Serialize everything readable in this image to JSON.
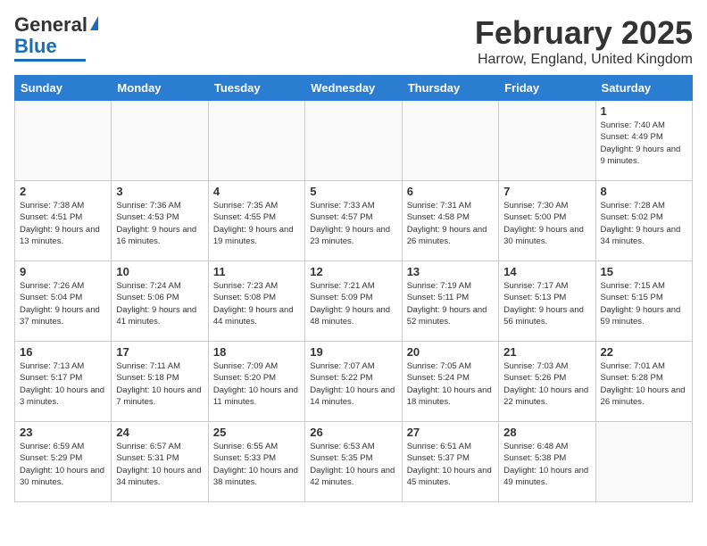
{
  "header": {
    "logo_line1": "General",
    "logo_line2": "Blue",
    "month_title": "February 2025",
    "location": "Harrow, England, United Kingdom"
  },
  "weekdays": [
    "Sunday",
    "Monday",
    "Tuesday",
    "Wednesday",
    "Thursday",
    "Friday",
    "Saturday"
  ],
  "weeks": [
    [
      {
        "day": "",
        "info": ""
      },
      {
        "day": "",
        "info": ""
      },
      {
        "day": "",
        "info": ""
      },
      {
        "day": "",
        "info": ""
      },
      {
        "day": "",
        "info": ""
      },
      {
        "day": "",
        "info": ""
      },
      {
        "day": "1",
        "info": "Sunrise: 7:40 AM\nSunset: 4:49 PM\nDaylight: 9 hours and 9 minutes."
      }
    ],
    [
      {
        "day": "2",
        "info": "Sunrise: 7:38 AM\nSunset: 4:51 PM\nDaylight: 9 hours and 13 minutes."
      },
      {
        "day": "3",
        "info": "Sunrise: 7:36 AM\nSunset: 4:53 PM\nDaylight: 9 hours and 16 minutes."
      },
      {
        "day": "4",
        "info": "Sunrise: 7:35 AM\nSunset: 4:55 PM\nDaylight: 9 hours and 19 minutes."
      },
      {
        "day": "5",
        "info": "Sunrise: 7:33 AM\nSunset: 4:57 PM\nDaylight: 9 hours and 23 minutes."
      },
      {
        "day": "6",
        "info": "Sunrise: 7:31 AM\nSunset: 4:58 PM\nDaylight: 9 hours and 26 minutes."
      },
      {
        "day": "7",
        "info": "Sunrise: 7:30 AM\nSunset: 5:00 PM\nDaylight: 9 hours and 30 minutes."
      },
      {
        "day": "8",
        "info": "Sunrise: 7:28 AM\nSunset: 5:02 PM\nDaylight: 9 hours and 34 minutes."
      }
    ],
    [
      {
        "day": "9",
        "info": "Sunrise: 7:26 AM\nSunset: 5:04 PM\nDaylight: 9 hours and 37 minutes."
      },
      {
        "day": "10",
        "info": "Sunrise: 7:24 AM\nSunset: 5:06 PM\nDaylight: 9 hours and 41 minutes."
      },
      {
        "day": "11",
        "info": "Sunrise: 7:23 AM\nSunset: 5:08 PM\nDaylight: 9 hours and 44 minutes."
      },
      {
        "day": "12",
        "info": "Sunrise: 7:21 AM\nSunset: 5:09 PM\nDaylight: 9 hours and 48 minutes."
      },
      {
        "day": "13",
        "info": "Sunrise: 7:19 AM\nSunset: 5:11 PM\nDaylight: 9 hours and 52 minutes."
      },
      {
        "day": "14",
        "info": "Sunrise: 7:17 AM\nSunset: 5:13 PM\nDaylight: 9 hours and 56 minutes."
      },
      {
        "day": "15",
        "info": "Sunrise: 7:15 AM\nSunset: 5:15 PM\nDaylight: 9 hours and 59 minutes."
      }
    ],
    [
      {
        "day": "16",
        "info": "Sunrise: 7:13 AM\nSunset: 5:17 PM\nDaylight: 10 hours and 3 minutes."
      },
      {
        "day": "17",
        "info": "Sunrise: 7:11 AM\nSunset: 5:18 PM\nDaylight: 10 hours and 7 minutes."
      },
      {
        "day": "18",
        "info": "Sunrise: 7:09 AM\nSunset: 5:20 PM\nDaylight: 10 hours and 11 minutes."
      },
      {
        "day": "19",
        "info": "Sunrise: 7:07 AM\nSunset: 5:22 PM\nDaylight: 10 hours and 14 minutes."
      },
      {
        "day": "20",
        "info": "Sunrise: 7:05 AM\nSunset: 5:24 PM\nDaylight: 10 hours and 18 minutes."
      },
      {
        "day": "21",
        "info": "Sunrise: 7:03 AM\nSunset: 5:26 PM\nDaylight: 10 hours and 22 minutes."
      },
      {
        "day": "22",
        "info": "Sunrise: 7:01 AM\nSunset: 5:28 PM\nDaylight: 10 hours and 26 minutes."
      }
    ],
    [
      {
        "day": "23",
        "info": "Sunrise: 6:59 AM\nSunset: 5:29 PM\nDaylight: 10 hours and 30 minutes."
      },
      {
        "day": "24",
        "info": "Sunrise: 6:57 AM\nSunset: 5:31 PM\nDaylight: 10 hours and 34 minutes."
      },
      {
        "day": "25",
        "info": "Sunrise: 6:55 AM\nSunset: 5:33 PM\nDaylight: 10 hours and 38 minutes."
      },
      {
        "day": "26",
        "info": "Sunrise: 6:53 AM\nSunset: 5:35 PM\nDaylight: 10 hours and 42 minutes."
      },
      {
        "day": "27",
        "info": "Sunrise: 6:51 AM\nSunset: 5:37 PM\nDaylight: 10 hours and 45 minutes."
      },
      {
        "day": "28",
        "info": "Sunrise: 6:48 AM\nSunset: 5:38 PM\nDaylight: 10 hours and 49 minutes."
      },
      {
        "day": "",
        "info": ""
      }
    ]
  ]
}
